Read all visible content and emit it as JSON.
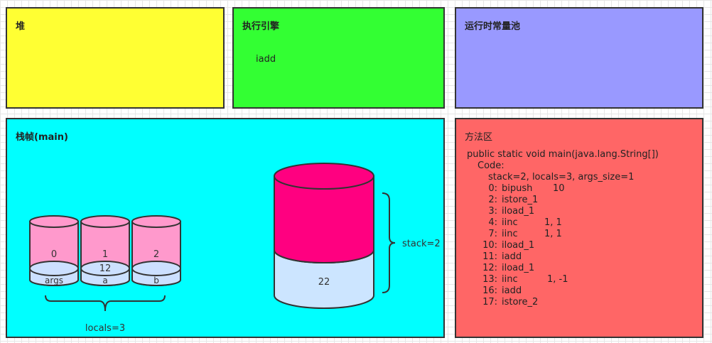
{
  "heap": {
    "title": "堆"
  },
  "engine": {
    "title": "执行引擎",
    "instruction": "iadd"
  },
  "pool": {
    "title": "运行时常量池"
  },
  "frame": {
    "title": "栈帧(main)",
    "locals": [
      {
        "index": "0",
        "value": "",
        "name": "args"
      },
      {
        "index": "1",
        "value": "12",
        "name": "a"
      },
      {
        "index": "2",
        "value": "",
        "name": "b"
      }
    ],
    "locals_label": "locals=3",
    "stack_value": "22",
    "stack_label": "stack=2"
  },
  "method": {
    "title": "方法区",
    "signature": "public static void main(java.lang.String[])",
    "code_label": "Code:",
    "stack_info": "stack=2, locals=3, args_size=1",
    "code": [
      {
        "offset": "0:",
        "op": "bipush",
        "args": "10"
      },
      {
        "offset": "2:",
        "op": "istore_1",
        "args": ""
      },
      {
        "offset": "3:",
        "op": "iload_1",
        "args": ""
      },
      {
        "offset": "4:",
        "op": "iinc",
        "args": "1, 1"
      },
      {
        "offset": "7:",
        "op": "iinc",
        "args": "1, 1"
      },
      {
        "offset": "10:",
        "op": "iload_1",
        "args": ""
      },
      {
        "offset": "11:",
        "op": "iadd",
        "args": ""
      },
      {
        "offset": "12:",
        "op": "iload_1",
        "args": ""
      },
      {
        "offset": "13:",
        "op": "iinc",
        "args": "1, -1"
      },
      {
        "offset": "16:",
        "op": "iadd",
        "args": ""
      },
      {
        "offset": "17:",
        "op": "istore_2",
        "args": ""
      }
    ]
  },
  "colors": {
    "heap": "#ffff33",
    "engine": "#33ff33",
    "pool": "#9999ff",
    "frame": "#00ffff",
    "method": "#ff6666",
    "local_cylinder": "#ff99cc",
    "local_base": "#cce0ff",
    "stack_top": "#ff0080",
    "stack_bottom": "#cce5ff"
  }
}
